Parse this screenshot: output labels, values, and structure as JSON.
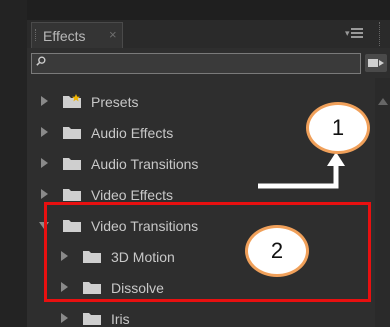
{
  "panel": {
    "tab_label": "Effects",
    "tab_close": "×"
  },
  "search": {
    "value": "",
    "placeholder": ""
  },
  "tree": [
    {
      "label": "Presets",
      "expanded": false,
      "icon": "presets-folder-icon"
    },
    {
      "label": "Audio Effects",
      "expanded": false,
      "icon": "folder-icon"
    },
    {
      "label": "Audio Transitions",
      "expanded": false,
      "icon": "folder-icon"
    },
    {
      "label": "Video Effects",
      "expanded": false,
      "icon": "folder-icon"
    },
    {
      "label": "Video Transitions",
      "expanded": true,
      "icon": "folder-icon"
    },
    {
      "label": "3D Motion",
      "expanded": false,
      "icon": "folder-icon"
    },
    {
      "label": "Dissolve",
      "expanded": false,
      "icon": "folder-icon"
    },
    {
      "label": "Iris",
      "expanded": false,
      "icon": "folder-icon"
    }
  ],
  "annotations": {
    "callout_1": "1",
    "callout_2": "2",
    "highlight_color": "#e81010",
    "callout_border_color": "#f0a05a"
  }
}
